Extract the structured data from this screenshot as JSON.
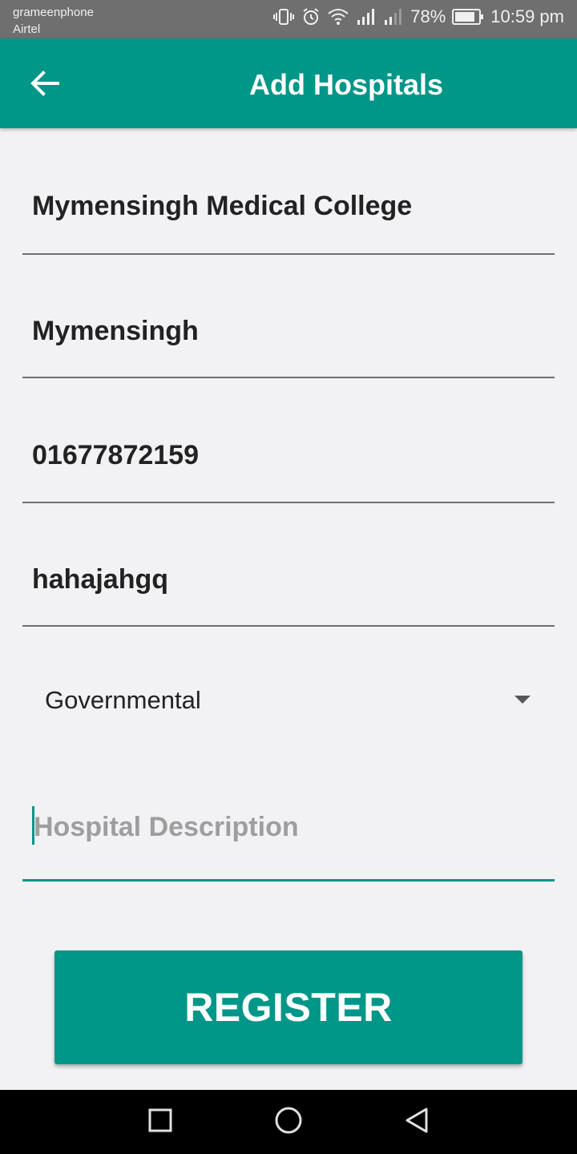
{
  "status_bar": {
    "carrier_1": "grameenphone",
    "carrier_2": "Airtel",
    "battery": "78%",
    "time": "10:59 pm",
    "icons": [
      "vibrate-icon",
      "alarm-icon",
      "wifi-icon",
      "signal-icon",
      "signal-icon",
      "battery-icon"
    ]
  },
  "app_bar": {
    "title": "Add Hospitals",
    "back_icon": "arrow-left-icon",
    "color": "#009688"
  },
  "form": {
    "hospital_name": "Mymensingh Medical College",
    "location": "Mymensingh",
    "phone": "01677872159",
    "other_field": "hahajahgq",
    "type_selected": "Governmental",
    "description_placeholder": "Hospital Description",
    "description_value": ""
  },
  "register_button": {
    "label": "REGISTER"
  },
  "nav_bar": {
    "icons": [
      "recent-apps-icon",
      "home-icon",
      "back-icon"
    ]
  }
}
